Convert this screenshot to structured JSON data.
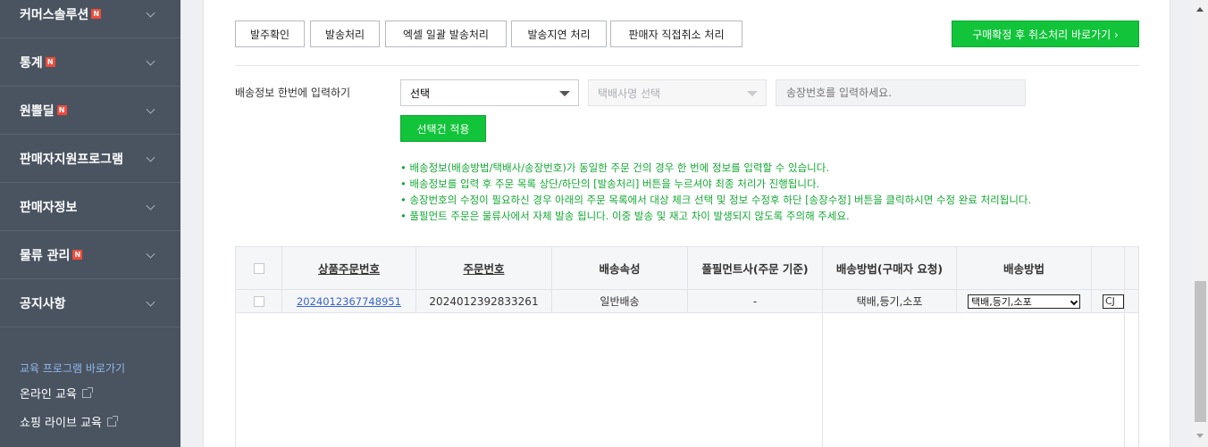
{
  "sidebar": {
    "items": [
      {
        "label": "커머스솔루션",
        "badge": "N"
      },
      {
        "label": "통계",
        "badge": "N"
      },
      {
        "label": "원쁠딜",
        "badge": "N"
      },
      {
        "label": "판매자지원프로그램",
        "badge": ""
      },
      {
        "label": "판매자정보",
        "badge": ""
      },
      {
        "label": "물류 관리",
        "badge": "N"
      },
      {
        "label": "공지사항",
        "badge": ""
      }
    ],
    "edu_title": "교육 프로그램 바로가기",
    "edu_links": [
      "온라인 교육",
      "쇼핑 라이브 교육"
    ]
  },
  "toolbar": {
    "buttons": [
      "발주확인",
      "발송처리",
      "엑셀 일괄 발송처리",
      "발송지연 처리",
      "판매자 직접취소 처리"
    ],
    "green_button": "구매확정 후 취소처리 바로가기 ›"
  },
  "bulk": {
    "label": "배송정보 한번에 입력하기",
    "method_select": "선택",
    "courier_select": "택배사명 선택",
    "invoice_placeholder": "송장번호를 입력하세요.",
    "apply_button": "선택건 적용"
  },
  "notes": [
    "• 배송정보(배송방법/택배사/송장번호)가 동일한 주문 건의 경우 한 번에 정보를 입력할 수 있습니다.",
    "• 배송정보를 입력 후 주문 목록 상단/하단의 [발송처리] 버튼을 누르셔야 최종 처리가 진행됩니다.",
    "• 송장번호의 수정이 필요하신 경우 아래의 주문 목록에서 대상 체크 선택 및 정보 수정후 하단 [송장수정] 버튼을 클릭하시면 수정 완료 처리됩니다.",
    "• 풀필먼트 주문은 물류사에서 자체 발송 됩니다. 이중 발송 및 재고 차이 발생되지 않도록 주의해 주세요."
  ],
  "table": {
    "headers": [
      "상품주문번호",
      "주문번호",
      "배송속성",
      "풀필먼트사(주문 기준)",
      "배송방법(구매자 요청)",
      "배송방법"
    ],
    "rows": [
      {
        "product_order_no": "2024012367748951",
        "order_no": "2024012392833261",
        "ship_attr": "일반배송",
        "fulfillment": "-",
        "buyer_method": "택배,등기,소포",
        "method_select": "택배,등기,소포",
        "courier": "CJ대한통운"
      }
    ]
  },
  "colors": {
    "sidebar_bg": "#4a5461",
    "accent_green": "#11c43a",
    "badge_red": "#f04b3a",
    "note_green": "#14a834",
    "link_blue": "#3a64c8"
  }
}
